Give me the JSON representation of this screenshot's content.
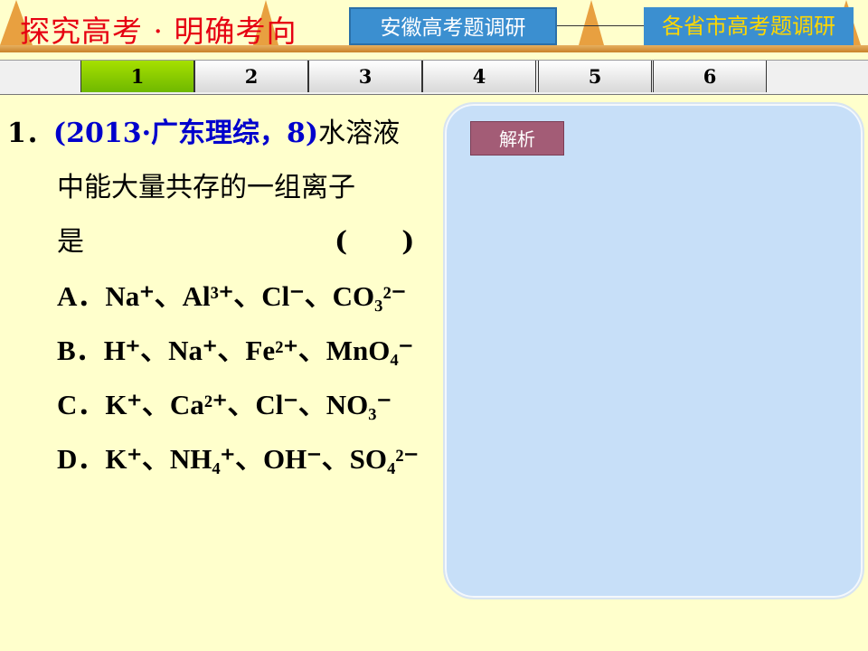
{
  "header": {
    "title": "探究高考 · 明确考向",
    "anhui_button": "安徽高考题调研",
    "province_button": "各省市高考题调研"
  },
  "tabs": [
    {
      "label": "1",
      "active": true
    },
    {
      "label": "2",
      "active": false
    },
    {
      "label": "3",
      "active": false
    },
    {
      "label": "4",
      "active": false
    },
    {
      "label": "5",
      "active": false
    },
    {
      "label": "6",
      "active": false
    }
  ],
  "question": {
    "number": "1．",
    "source": "(2013·广东理综，8)",
    "stem_part1": "水溶液",
    "stem_part2": "中能大量共存的一组离子",
    "stem_part3": "是",
    "answer_bracket": "(　　)",
    "options": [
      {
        "label": "A．",
        "ions": "Na⁺、Al³⁺、Cl⁻、CO₃²⁻"
      },
      {
        "label": "B．",
        "ions": "H⁺、Na⁺、Fe²⁺、MnO₄⁻"
      },
      {
        "label": "C．",
        "ions": "K⁺、Ca²⁺、Cl⁻、NO₃⁻"
      },
      {
        "label": "D．",
        "ions": "K⁺、NH₄⁺、OH⁻、SO₄²⁻"
      }
    ]
  },
  "analysis": {
    "button_label": "解析"
  },
  "colors": {
    "background": "#FFFFCC",
    "title_red": "#E60012",
    "button_blue": "#3B8FD0",
    "active_tab_green": "#8CCB00",
    "panel_blue": "#C7DFF8",
    "analysis_button": "#A35C76"
  }
}
